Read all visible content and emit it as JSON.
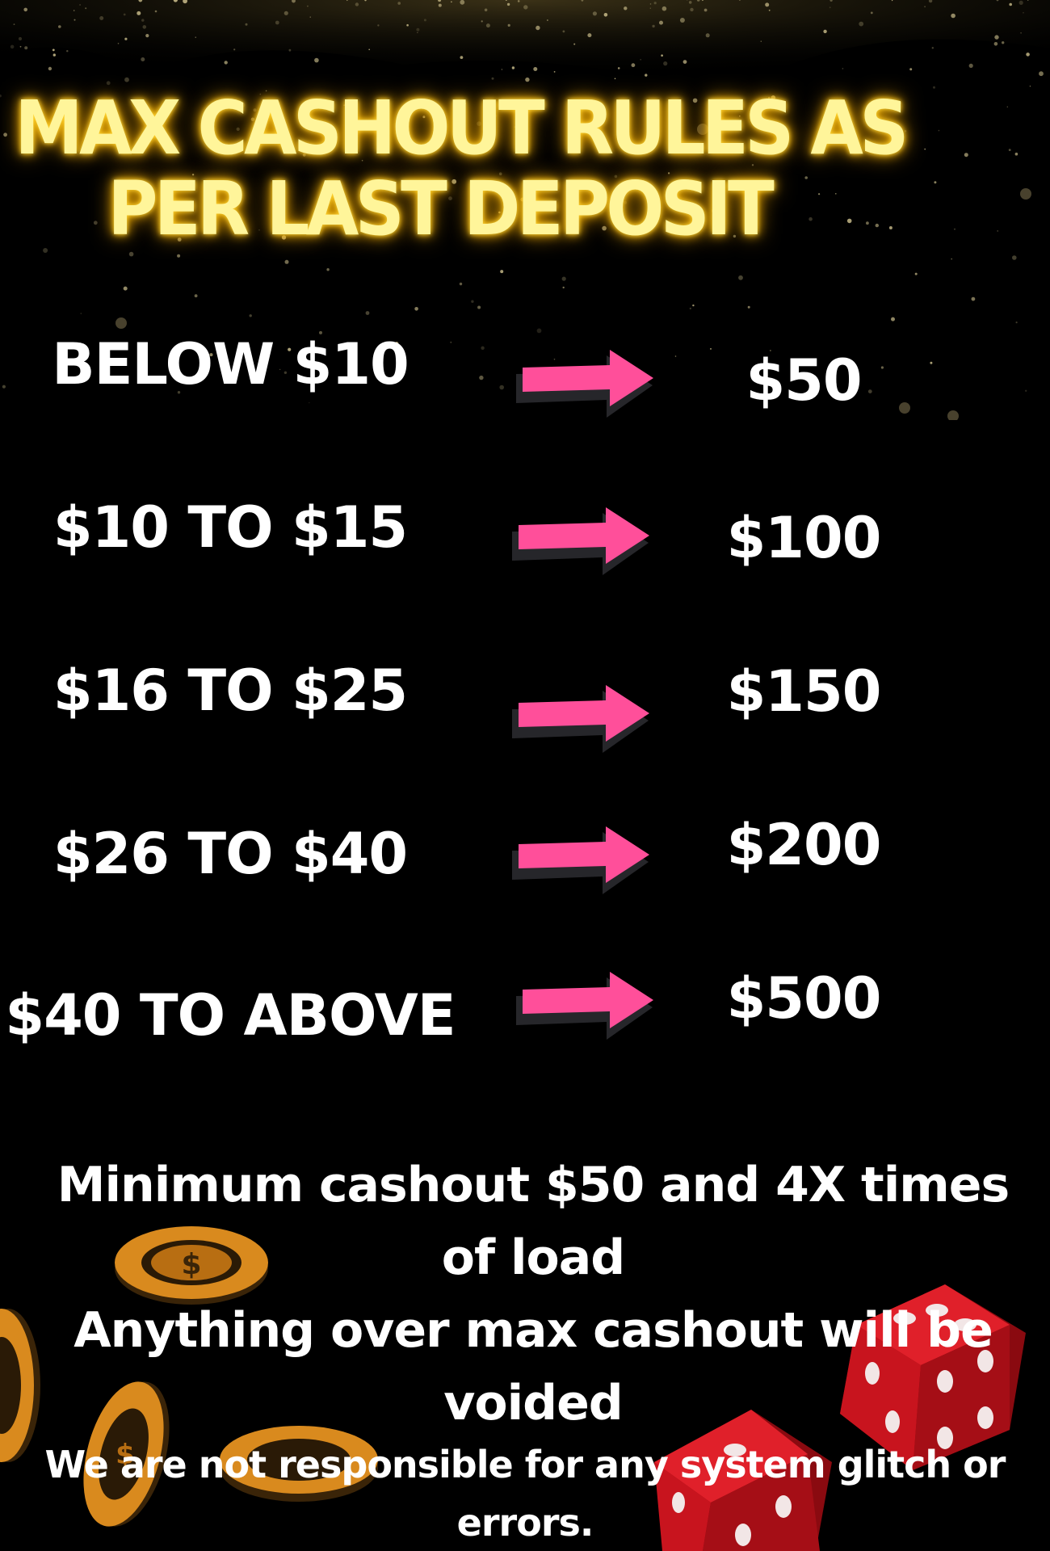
{
  "title": {
    "line1": "MAX CASHOUT RULES AS",
    "line2": "PER LAST DEPOSIT",
    "glow_color": "#ffd93a",
    "text_color": "#fff59a"
  },
  "rules": [
    {
      "deposit": "BELOW $10",
      "cashout": "$50"
    },
    {
      "deposit": "$10 TO $15",
      "cashout": "$100"
    },
    {
      "deposit": "$16 TO $25",
      "cashout": "$150"
    },
    {
      "deposit": "$26 TO $40",
      "cashout": "$200"
    },
    {
      "deposit": "$40 TO ABOVE",
      "cashout": "$500"
    }
  ],
  "arrow": {
    "icon": "right-arrow-icon",
    "color": "#ff4f9a",
    "shadow_color": "#2a2a2e"
  },
  "notes": {
    "minimum": "Minimum cashout $50 and 4X times of load",
    "voided": "Anything over max cashout will be voided",
    "disclaimer": "We are not responsible for any system glitch or errors."
  },
  "decorations": {
    "chips_icon": "casino-chip-icon",
    "dice_icon": "dice-icon",
    "chip_color": "#d98a1e",
    "dice_color": "#c8141e"
  }
}
